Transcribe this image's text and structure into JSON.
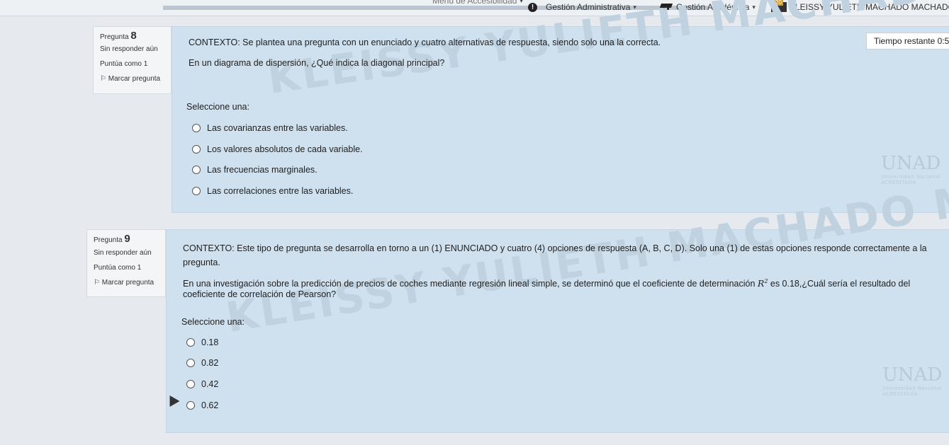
{
  "topbar": {
    "accessibility_label": "Menú de Accesibilidad",
    "admin_label": "Gestión Administrativa",
    "academic_label": "Gestión Académica",
    "user_name": "KLEISSY YULIETH MACHADO MACHADO",
    "notifications_count": "20"
  },
  "timer": {
    "label": "Tiempo restante 0:5"
  },
  "watermark": {
    "text": "KLEISSY YULIETH MACHADO MACHADO"
  },
  "logo": {
    "name": "UNAD",
    "line1": "Universidad Nacional",
    "line2": "ACREDITADA"
  },
  "questions": [
    {
      "label": "Pregunta",
      "number": "8",
      "status": "Sin responder aún",
      "score": "Puntúa como 1",
      "flag": "Marcar pregunta",
      "context": "CONTEXTO: Se plantea una pregunta con un enunciado y cuatro alternativas de respuesta, siendo solo una la correcta.",
      "question": "En un diagrama de dispersión, ¿Qué indica la diagonal principal?",
      "select_label": "Seleccione una:",
      "options": [
        "Las covarianzas entre las variables.",
        "Los valores absolutos de cada variable.",
        "Las frecuencias marginales.",
        "Las correlaciones entre las variables."
      ]
    },
    {
      "label": "Pregunta",
      "number": "9",
      "status": "Sin responder aún",
      "score": "Puntúa como 1",
      "flag": "Marcar pregunta",
      "context_line1": "CONTEXTO: Este tipo de pregunta se desarrolla en torno a un (1) ENUNCIADO y cuatro (4) opciones de respuesta (A, B, C, D). Solo una (1) de estas opciones responde correctamente a la",
      "context_line2": "pregunta.",
      "question_line1_a": "En una investigación sobre la predicción de precios de coches mediante regresión lineal simple, se determinó que el coeficiente de determinación ",
      "question_symbol": "R",
      "question_exponent": "2",
      "question_line1_b": " es 0.18,¿Cuál sería el resultado del",
      "question_line2": "coeficiente de correlación de Pearson?",
      "select_label": "Seleccione una:",
      "options": [
        "0.18",
        "0.82",
        "0.42",
        "0.62"
      ]
    }
  ]
}
